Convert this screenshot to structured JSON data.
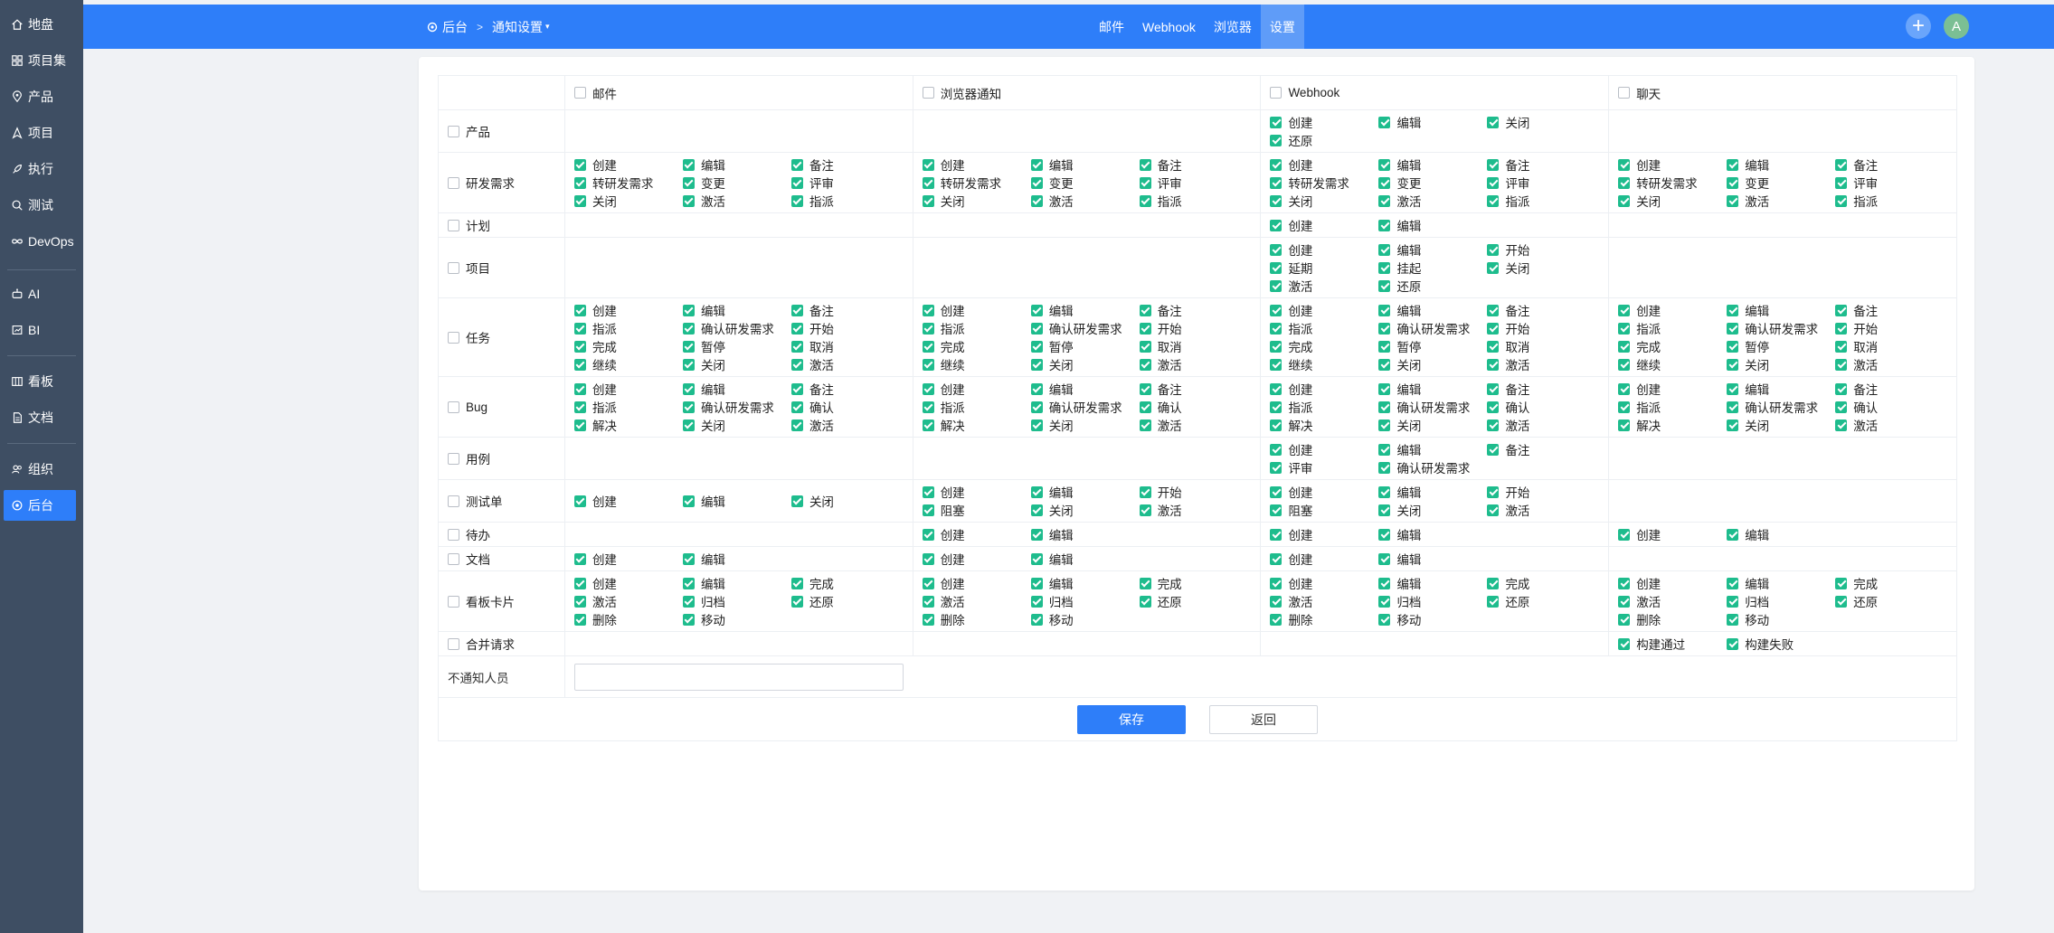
{
  "sidebar": {
    "items": [
      {
        "label": "地盘",
        "icon": "home-icon"
      },
      {
        "label": "项目集",
        "icon": "grid-icon"
      },
      {
        "label": "产品",
        "icon": "pin-icon"
      },
      {
        "label": "项目",
        "icon": "compass-icon"
      },
      {
        "label": "执行",
        "icon": "rocket-icon"
      },
      {
        "label": "测试",
        "icon": "search-icon"
      },
      {
        "label": "DevOps",
        "icon": "infinity-icon"
      },
      {
        "label": "AI",
        "icon": "robot-icon"
      },
      {
        "label": "BI",
        "icon": "chart-icon"
      },
      {
        "label": "看板",
        "icon": "kanban-icon"
      },
      {
        "label": "文档",
        "icon": "doc-icon"
      },
      {
        "label": "组织",
        "icon": "people-icon"
      },
      {
        "label": "后台",
        "icon": "settings-icon"
      }
    ],
    "active": "后台"
  },
  "header": {
    "breadcrumb": {
      "root": "后台",
      "current": "通知设置"
    },
    "tabs": [
      "邮件",
      "Webhook",
      "浏览器",
      "设置"
    ],
    "active_tab": "设置",
    "avatar": "A"
  },
  "columns": [
    "邮件",
    "浏览器通知",
    "Webhook",
    "聊天"
  ],
  "rows": [
    {
      "label": "产品",
      "cells": [
        [],
        [],
        [
          "创建",
          "编辑",
          "关闭",
          "还原"
        ],
        []
      ]
    },
    {
      "label": "研发需求",
      "cells": [
        [
          "创建",
          "编辑",
          "备注",
          "转研发需求",
          "变更",
          "评审",
          "关闭",
          "激活",
          "指派"
        ],
        [
          "创建",
          "编辑",
          "备注",
          "转研发需求",
          "变更",
          "评审",
          "关闭",
          "激活",
          "指派"
        ],
        [
          "创建",
          "编辑",
          "备注",
          "转研发需求",
          "变更",
          "评审",
          "关闭",
          "激活",
          "指派"
        ],
        [
          "创建",
          "编辑",
          "备注",
          "转研发需求",
          "变更",
          "评审",
          "关闭",
          "激活",
          "指派"
        ]
      ]
    },
    {
      "label": "计划",
      "cells": [
        [],
        [],
        [
          "创建",
          "编辑"
        ],
        []
      ]
    },
    {
      "label": "项目",
      "cells": [
        [],
        [],
        [
          "创建",
          "编辑",
          "开始",
          "延期",
          "挂起",
          "关闭",
          "激活",
          "还原"
        ],
        []
      ]
    },
    {
      "label": "任务",
      "cells": [
        [
          "创建",
          "编辑",
          "备注",
          "指派",
          "确认研发需求",
          "开始",
          "完成",
          "暂停",
          "取消",
          "继续",
          "关闭",
          "激活"
        ],
        [
          "创建",
          "编辑",
          "备注",
          "指派",
          "确认研发需求",
          "开始",
          "完成",
          "暂停",
          "取消",
          "继续",
          "关闭",
          "激活"
        ],
        [
          "创建",
          "编辑",
          "备注",
          "指派",
          "确认研发需求",
          "开始",
          "完成",
          "暂停",
          "取消",
          "继续",
          "关闭",
          "激活"
        ],
        [
          "创建",
          "编辑",
          "备注",
          "指派",
          "确认研发需求",
          "开始",
          "完成",
          "暂停",
          "取消",
          "继续",
          "关闭",
          "激活"
        ]
      ]
    },
    {
      "label": "Bug",
      "cells": [
        [
          "创建",
          "编辑",
          "备注",
          "指派",
          "确认研发需求",
          "确认",
          "解决",
          "关闭",
          "激活"
        ],
        [
          "创建",
          "编辑",
          "备注",
          "指派",
          "确认研发需求",
          "确认",
          "解决",
          "关闭",
          "激活"
        ],
        [
          "创建",
          "编辑",
          "备注",
          "指派",
          "确认研发需求",
          "确认",
          "解决",
          "关闭",
          "激活"
        ],
        [
          "创建",
          "编辑",
          "备注",
          "指派",
          "确认研发需求",
          "确认",
          "解决",
          "关闭",
          "激活"
        ]
      ]
    },
    {
      "label": "用例",
      "cells": [
        [],
        [],
        [
          "创建",
          "编辑",
          "备注",
          "评审",
          "确认研发需求"
        ],
        []
      ]
    },
    {
      "label": "测试单",
      "cells": [
        [
          "创建",
          "编辑",
          "关闭"
        ],
        [
          "创建",
          "编辑",
          "开始",
          "阻塞",
          "关闭",
          "激活"
        ],
        [
          "创建",
          "编辑",
          "开始",
          "阻塞",
          "关闭",
          "激活"
        ],
        []
      ]
    },
    {
      "label": "待办",
      "cells": [
        [],
        [
          "创建",
          "编辑"
        ],
        [
          "创建",
          "编辑"
        ],
        [
          "创建",
          "编辑"
        ]
      ]
    },
    {
      "label": "文档",
      "cells": [
        [
          "创建",
          "编辑"
        ],
        [
          "创建",
          "编辑"
        ],
        [
          "创建",
          "编辑"
        ],
        []
      ]
    },
    {
      "label": "看板卡片",
      "cells": [
        [
          "创建",
          "编辑",
          "完成",
          "激活",
          "归档",
          "还原",
          "删除",
          "移动"
        ],
        [
          "创建",
          "编辑",
          "完成",
          "激活",
          "归档",
          "还原",
          "删除",
          "移动"
        ],
        [
          "创建",
          "编辑",
          "完成",
          "激活",
          "归档",
          "还原",
          "删除",
          "移动"
        ],
        [
          "创建",
          "编辑",
          "完成",
          "激活",
          "归档",
          "还原",
          "删除",
          "移动"
        ]
      ]
    },
    {
      "label": "合并请求",
      "cells": [
        [],
        [],
        [],
        [
          "构建通过",
          "构建失败"
        ]
      ]
    }
  ],
  "exclude": {
    "label": "不通知人员",
    "value": ""
  },
  "buttons": {
    "save": "保存",
    "back": "返回"
  },
  "colors": {
    "accent": "#2e7ef9",
    "sidebar": "#3e4e63",
    "check": "#1ebc8d"
  }
}
